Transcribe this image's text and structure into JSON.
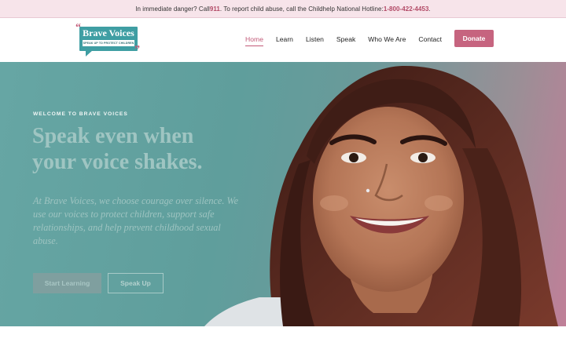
{
  "alert": {
    "prefix": "In immediate danger? Call ",
    "emergency_number": "911",
    "middle": ". To report child abuse, call the Childhelp National Hotline: ",
    "hotline_number": "1-800-422-4453",
    "suffix": "."
  },
  "logo": {
    "title": "Brave Voices",
    "tagline": "SPEAK UP TO PROTECT CHILDREN",
    "quote_open": "“",
    "quote_close": "”"
  },
  "nav": {
    "items": [
      {
        "label": "Home",
        "active": true
      },
      {
        "label": "Learn",
        "active": false
      },
      {
        "label": "Listen",
        "active": false
      },
      {
        "label": "Speak",
        "active": false
      },
      {
        "label": "Who We Are",
        "active": false
      },
      {
        "label": "Contact",
        "active": false
      }
    ],
    "donate_label": "Donate"
  },
  "hero": {
    "eyebrow": "WELCOME TO BRAVE VOICES",
    "title": "Speak even when your voice shakes.",
    "description": "At Brave Voices, we choose courage over silence. We use our voices to protect children, support safe relationships, and help prevent childhood sexual abuse.",
    "primary_button": "Start Learning",
    "secondary_button": "Speak Up"
  },
  "colors": {
    "accent": "#c25a78",
    "teal": "#3f9ea3",
    "alert_bg": "#f7e4ea"
  }
}
